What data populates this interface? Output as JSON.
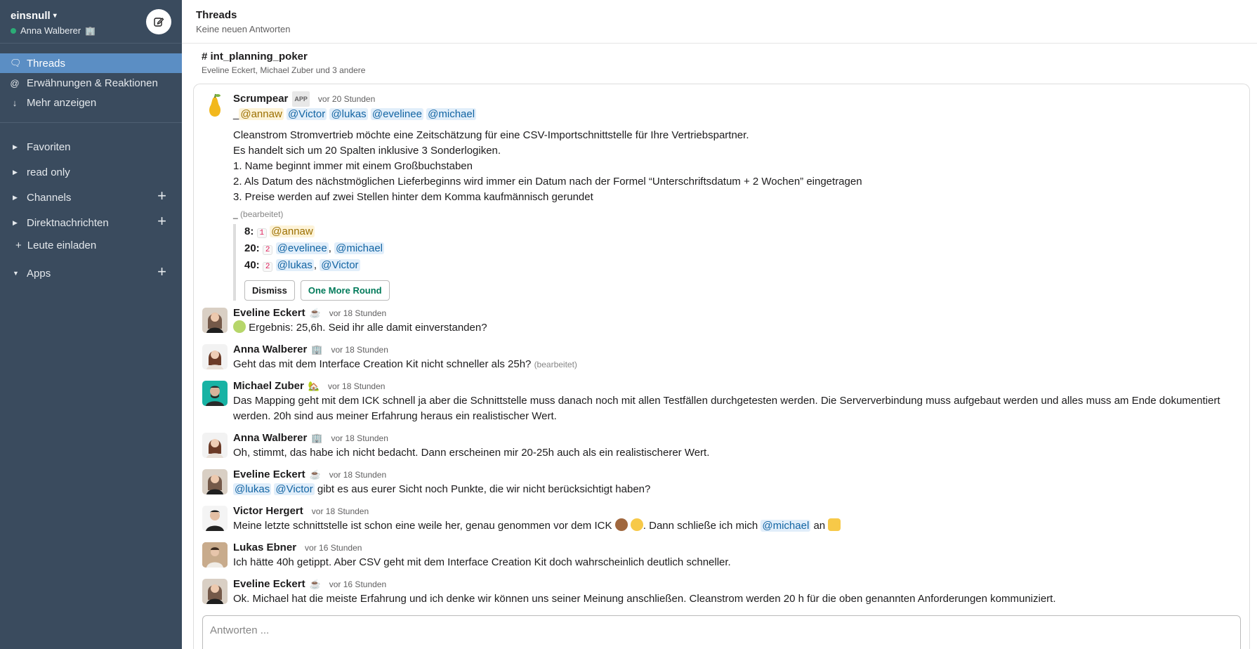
{
  "workspace": {
    "name": "einsnull",
    "user": "Anna Walberer",
    "user_status_emoji": "🏢"
  },
  "sidebar": {
    "nav": [
      {
        "label": "Threads",
        "icon": "threads-icon"
      },
      {
        "label": "Erwähnungen & Reaktionen",
        "icon": "at-icon"
      },
      {
        "label": "Mehr anzeigen",
        "icon": "arrow-down-icon"
      }
    ],
    "sections": [
      {
        "label": "Favoriten",
        "has_add": false
      },
      {
        "label": "read only",
        "has_add": false
      },
      {
        "label": "Channels",
        "has_add": true
      },
      {
        "label": "Direktnachrichten",
        "has_add": true
      }
    ],
    "invite": "Leute einladen",
    "apps": "Apps"
  },
  "header": {
    "title": "Threads",
    "subtitle": "Keine neuen Antworten"
  },
  "channel": {
    "name": "# int_planning_poker",
    "members": "Eveline Eckert, Michael Zuber und 3 andere"
  },
  "scrumpear": {
    "name": "Scrumpear",
    "badge": "APP",
    "time": "vor 20 Stunden",
    "prefix": "_",
    "mentions": [
      "@annaw",
      "@Victor",
      "@lukas",
      "@evelinee",
      "@michael"
    ],
    "lines": [
      "Cleanstrom Stromvertrieb möchte eine Zeitschätzung für eine CSV-Importschnittstelle für Ihre Vertriebspartner.",
      "Es handelt sich um 20 Spalten inklusive 3 Sonderlogiken.",
      "1. Name beginnt immer mit einem Großbuchstaben",
      "2. Als Datum des nächstmöglichen Lieferbeginns wird immer ein Datum nach der Formel “Unterschriftsdatum + 2 Wochen” eingetragen",
      "3. Preise werden auf zwei Stellen hinter dem Komma kaufmännisch gerundet"
    ],
    "edited_prefix": "_",
    "edited": "(bearbeitet)",
    "votes": [
      {
        "label": "8:",
        "count": "1",
        "users": [
          "@annaw"
        ]
      },
      {
        "label": "20:",
        "count": "2",
        "users": [
          "@evelinee",
          "@michael"
        ]
      },
      {
        "label": "40:",
        "count": "2",
        "users": [
          "@lukas",
          "@Victor"
        ]
      }
    ],
    "buttons": {
      "dismiss": "Dismiss",
      "more": "One More Round"
    }
  },
  "messages": [
    {
      "name": "Eveline Eckert",
      "status": "☕",
      "time": "vor 18 Stunden",
      "text": "Ergebnis: 25,6h. Seid ihr alle damit einverstanden?"
    },
    {
      "name": "Anna Walberer",
      "status": "🏢",
      "time": "vor 18 Stunden",
      "text": "Geht das mit dem Interface Creation Kit nicht schneller als 25h?",
      "edited": "(bearbeitet)"
    },
    {
      "name": "Michael Zuber",
      "status": "🏡",
      "time": "vor 18 Stunden",
      "text": "Das Mapping geht mit dem ICK schnell ja aber die Schnittstelle muss danach noch mit allen Testfällen durchgetesten werden. Die Serververbindung muss aufgebaut werden und alles muss am Ende dokumentiert werden. 20h sind aus meiner Erfahrung heraus ein realistischer Wert."
    },
    {
      "name": "Anna Walberer",
      "status": "🏢",
      "time": "vor 18 Stunden",
      "text": "Oh, stimmt, das habe ich nicht bedacht. Dann erscheinen mir 20-25h auch als ein realistischerer Wert."
    },
    {
      "name": "Eveline Eckert",
      "status": "☕",
      "time": "vor 18 Stunden",
      "mentions": [
        "@lukas",
        "@Victor"
      ],
      "text": "gibt es aus eurer Sicht noch Punkte, die wir nicht berücksichtigt haben?"
    },
    {
      "name": "Victor Hergert",
      "time": "vor 18 Stunden",
      "text_a": "Meine letzte schnittstelle ist schon eine weile her, genau genommen vor dem ICK",
      "text_b": ". Dann schließe ich mich",
      "mention": "@michael",
      "text_c": "an"
    },
    {
      "name": "Lukas Ebner",
      "time": "vor 16 Stunden",
      "text": "Ich hätte 40h getippt. Aber CSV geht mit dem Interface Creation Kit doch wahrscheinlich deutlich schneller."
    },
    {
      "name": "Eveline Eckert",
      "status": "☕",
      "time": "vor 16 Stunden",
      "text": "Ok. Michael hat die meiste Erfahrung und ich denke wir können uns seiner Meinung anschließen. Cleanstrom werden 20 h für die oben genannten Anforderungen kommuniziert."
    }
  ],
  "reply": {
    "placeholder": "Antworten ..."
  }
}
